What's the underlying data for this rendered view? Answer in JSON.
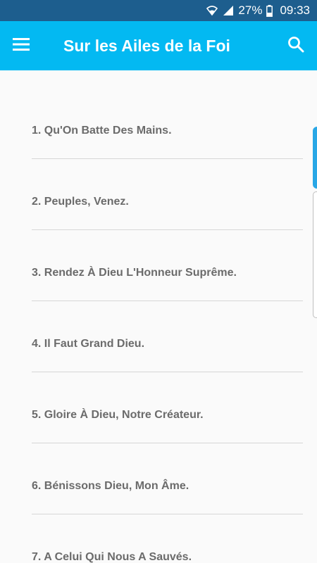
{
  "status_bar": {
    "battery": "27%",
    "time": "09:33"
  },
  "app_bar": {
    "title": "Sur les Ailes de la Foi",
    "menu_icon": "hamburger-menu-icon",
    "search_icon": "search-icon"
  },
  "colors": {
    "status_bar": "#1d5e8e",
    "app_bar": "#03b9f2",
    "item_text": "#6b6b6b",
    "divider": "#d6d6d6"
  },
  "songs": [
    {
      "label": "1. Qu'On Batte Des Mains."
    },
    {
      "label": "2. Peuples, Venez."
    },
    {
      "label": "3. Rendez À Dieu L'Honneur Suprême."
    },
    {
      "label": "4. Il Faut Grand Dieu."
    },
    {
      "label": "5. Gloire À Dieu, Notre Créateur."
    },
    {
      "label": "6. Bénissons Dieu, Mon Âme."
    },
    {
      "label": "7. A Celui Qui Nous A Sauvés."
    }
  ]
}
